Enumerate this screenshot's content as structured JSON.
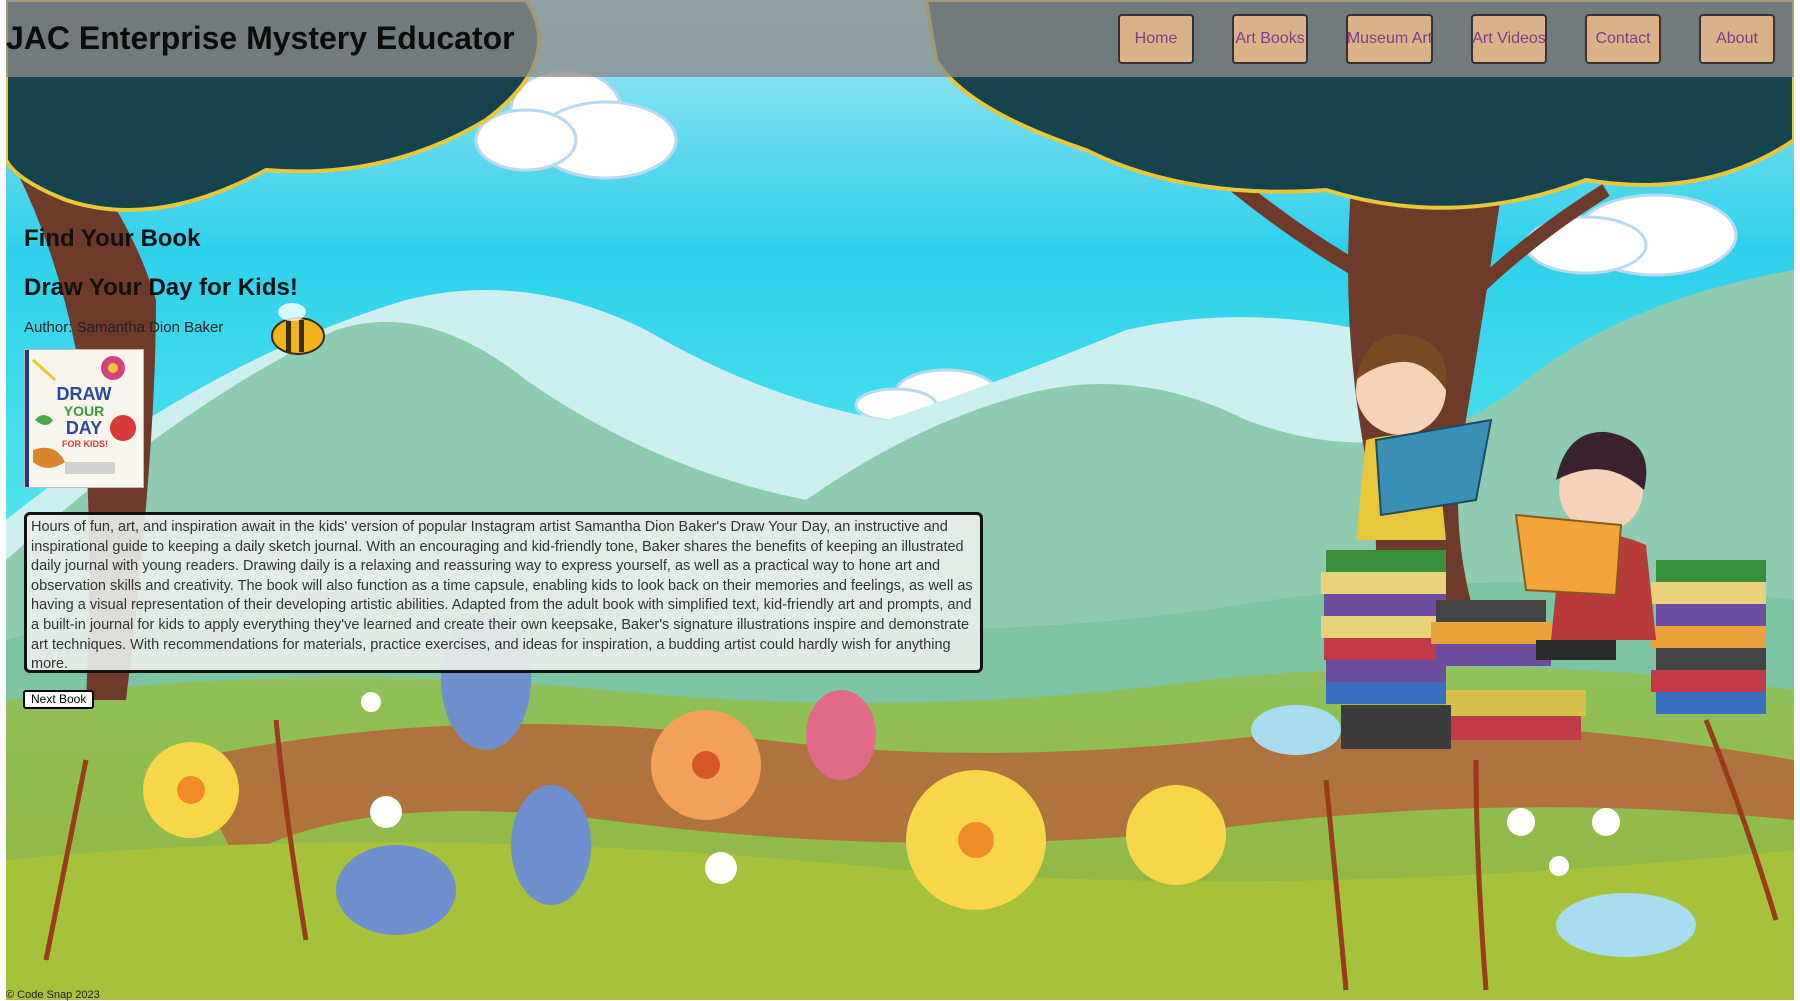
{
  "header": {
    "title": "JAC Enterprise Mystery Educator",
    "nav": [
      "Home",
      "Art Books",
      "Museum Art",
      "Art Videos",
      "Contact",
      "About"
    ]
  },
  "main": {
    "heading": "Find Your Book",
    "book": {
      "title": "Draw Your Day for Kids!",
      "author": "Author: Samantha Dion Baker",
      "cover_text": [
        "DRAW",
        "YOUR",
        "DAY",
        "FOR KIDS!"
      ],
      "description": "Hours of fun, art, and inspiration await in the kids' version of popular Instagram artist Samantha Dion Baker's Draw Your Day, an instructive and inspirational guide to keeping a daily sketch journal. With an encouraging and kid-friendly tone, Baker shares the benefits of keeping an illustrated daily journal with young readers. Drawing daily is a relaxing and reassuring way to express yourself, as well as a practical way to hone art and observation skills and creativity. The book will also function as a time capsule, enabling kids to look back on their memories and feelings, as well as having a visual representation of their developing artistic abilities. Adapted from the adult book with simplified text, kid-friendly art and prompts, and a built-in journal for kids to apply everything they've learned and create their own keepsake, Baker's signature illustrations inspire and demonstrate art techniques. With recommendations for materials, practice exercises, and ideas for inspiration, a budding artist could hardly wish for anything more."
    },
    "next_button": "Next Book"
  },
  "footer": {
    "copyright": "© Code Snap 2023"
  },
  "colors": {
    "sky": "#2fd0ec",
    "mountain": "#8fcbb0",
    "grass": "#8fb53c",
    "tree_trunk": "#6e3b2a",
    "foliage": "#16434d",
    "nav_button": "#d9b287",
    "nav_text": "#7a3d8c"
  },
  "background_scene": {
    "depicts": [
      "sky",
      "clouds",
      "mountains",
      "trees",
      "bee",
      "flowers",
      "girl reading book",
      "boy reading book",
      "stacked books"
    ]
  }
}
